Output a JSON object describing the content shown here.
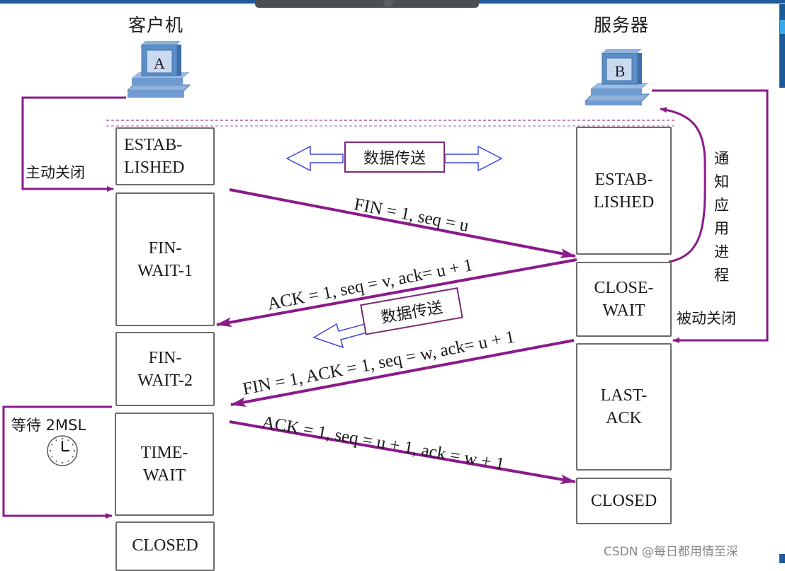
{
  "diagram": {
    "client": {
      "title": "客户机",
      "monitor_letter": "A",
      "action_label": "主动关闭"
    },
    "server": {
      "title": "服务器",
      "monitor_letter": "B",
      "action_label": "被动关闭",
      "notify_label": "通知\n应用\n进程"
    },
    "client_states": [
      "ESTAB-\nLISHED",
      "FIN-\nWAIT-1",
      "FIN-\nWAIT-2",
      "TIME-\nWAIT",
      "CLOSED"
    ],
    "server_states": [
      "ESTAB-\nLISHED",
      "CLOSE-\nWAIT",
      "LAST-\nACK",
      "CLOSED"
    ],
    "messages": [
      {
        "text": "FIN = 1, seq = u",
        "direction": "client-to-server"
      },
      {
        "text": "ACK = 1, seq = v, ack= u + 1",
        "direction": "server-to-client"
      },
      {
        "text": "FIN = 1, ACK = 1, seq = w, ack= u + 1",
        "direction": "server-to-client"
      },
      {
        "text": "ACK = 1, seq = u + 1, ack = w + 1",
        "direction": "client-to-server"
      }
    ],
    "data_transfer_label": "数据传送",
    "data_transfer_half_label": "数据传送",
    "wait_label": "等待 2MSL",
    "wait_icon": "clock-icon",
    "colors": {
      "arrow": "#8b1a8b",
      "hollow_arrow": "#3c46d8",
      "box_border": "#6c6c6c",
      "monitor": "#5b8fc8"
    }
  },
  "watermark": "CSDN @每日都用情至深"
}
